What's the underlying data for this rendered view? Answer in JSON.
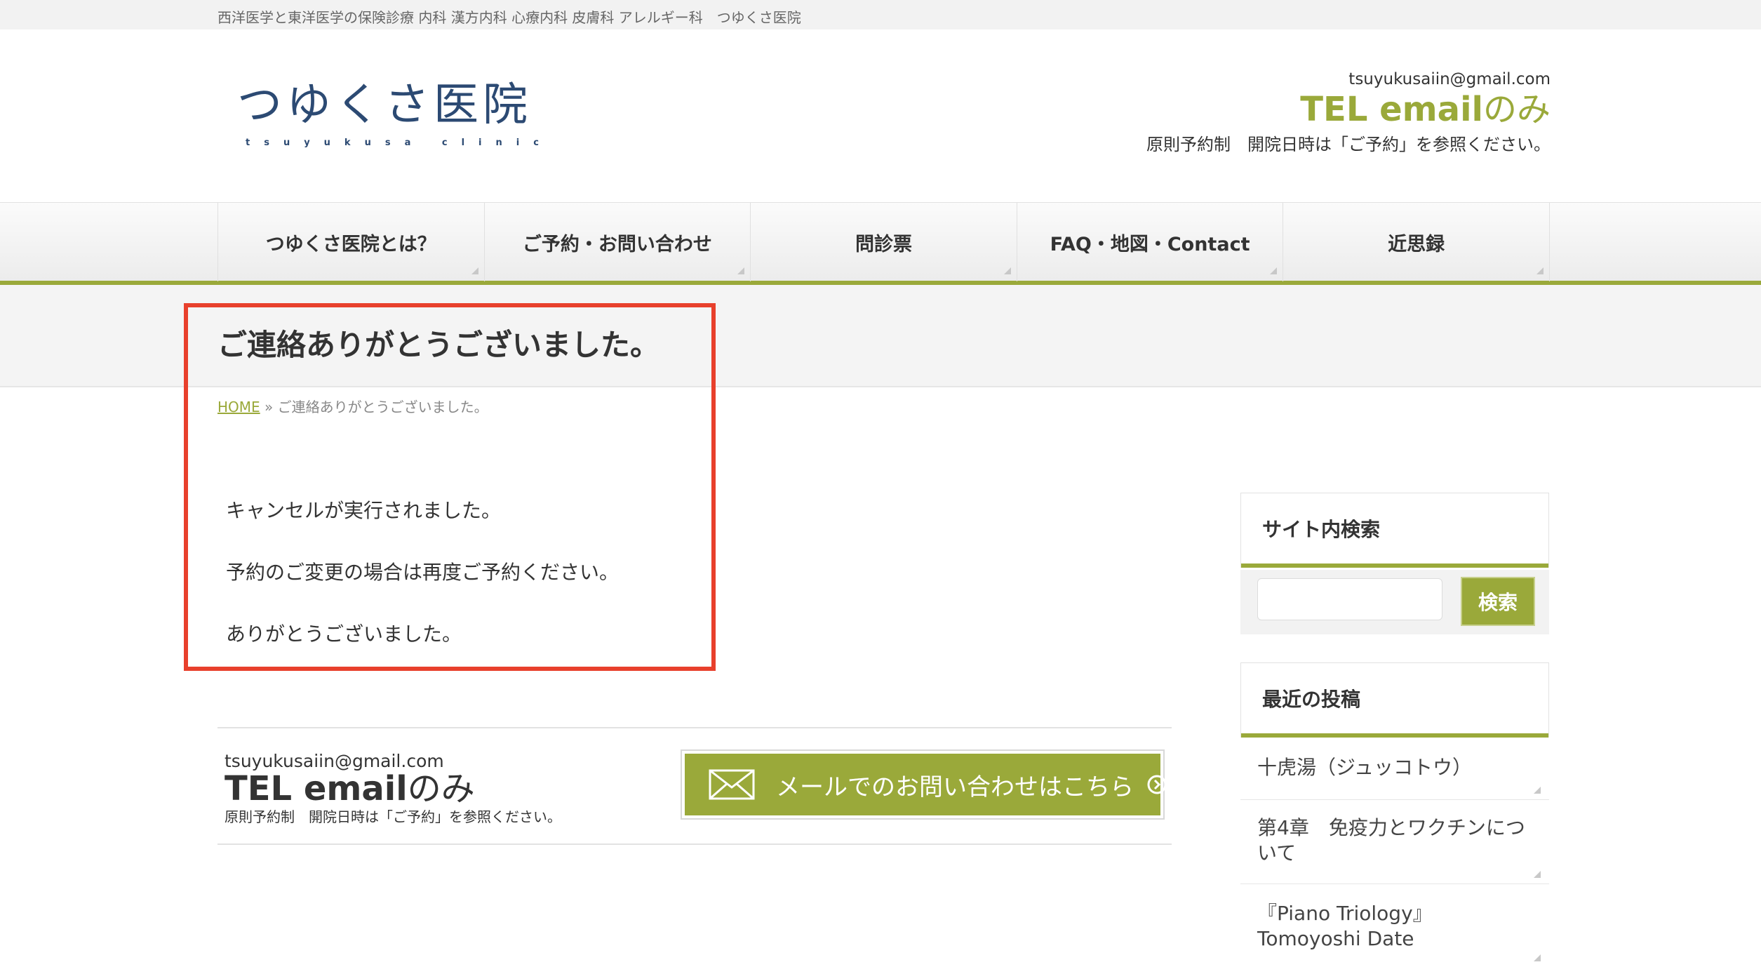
{
  "topbar": {
    "tagline": "西洋医学と東洋医学の保険診療 内科 漢方内科 心療内科 皮膚科 アレルギー科　つゆくさ医院"
  },
  "header": {
    "logo_main": "つゆくさ医院",
    "logo_sub": "tsuyukusa clinic",
    "email": "tsuyukusaiin@gmail.com",
    "tel_prefix": "TEL email",
    "tel_suffix": "のみ",
    "note": "原則予約制　開院日時は「ご予約」を参照ください。"
  },
  "nav": {
    "items": [
      {
        "label": "つゆくさ医院とは？"
      },
      {
        "label": "ご予約・お問い合わせ"
      },
      {
        "label": "問診票"
      },
      {
        "label": "FAQ・地図・Contact"
      },
      {
        "label": "近思録"
      }
    ]
  },
  "page": {
    "title": "ご連絡ありがとうございました。"
  },
  "breadcrumb": {
    "home": "HOME",
    "separator": "»",
    "current": "ご連絡ありがとうございました。"
  },
  "content": {
    "lines": [
      "キャンセルが実行されました。",
      "予約のご変更の場合は再度ご予約ください。",
      "ありがとうございました。"
    ]
  },
  "contact_box": {
    "email": "tsuyukusaiin@gmail.com",
    "tel_prefix": "TEL email",
    "tel_suffix": "のみ",
    "note": "原則予約制　開院日時は「ご予約」を参照ください。",
    "mail_button_label": "メールでのお問い合わせはこちら"
  },
  "sidebar": {
    "search_title": "サイト内検索",
    "search_button": "検索",
    "search_value": "",
    "recent_title": "最近の投稿",
    "posts": [
      {
        "title": "十虎湯（ジュッコトウ）"
      },
      {
        "title": "第4章　免疫力とワクチンについて"
      },
      {
        "title": "『Piano Triology』Tomoyoshi Date"
      }
    ]
  },
  "colors": {
    "accent": "#9aa93a",
    "logo": "#2c4a73",
    "highlight": "#e8402c"
  }
}
